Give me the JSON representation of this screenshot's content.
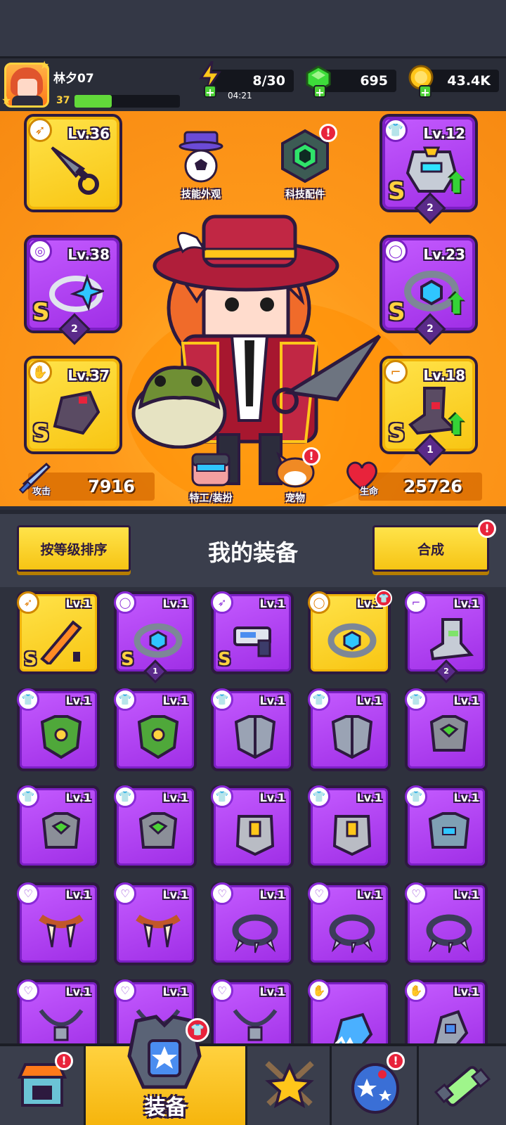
{
  "player": {
    "name": "林夕07",
    "level": "37",
    "xp_fraction": 0.35
  },
  "resources": {
    "energy": "8/30",
    "energy_timer": "04:21",
    "gems": "695",
    "coins": "43.4K"
  },
  "features": {
    "skill_skin": "技能外观",
    "tech_parts": "科技配件",
    "agent_outfit": "特工/装扮",
    "pet": "宠物"
  },
  "equipped": {
    "weapon": {
      "level": "Lv.36",
      "type_icon": "kunai-icon"
    },
    "ring": {
      "level": "Lv.38",
      "rank": "S",
      "stars": "2",
      "type_icon": "ring-icon"
    },
    "gloves": {
      "level": "Lv.37",
      "rank": "S",
      "type_icon": "glove-icon"
    },
    "armor": {
      "level": "Lv.12",
      "rank": "S",
      "stars": "2",
      "type_icon": "shirt-icon",
      "upgradable": true
    },
    "belt": {
      "level": "Lv.23",
      "rank": "S",
      "stars": "2",
      "type_icon": "belt-icon",
      "upgradable": true
    },
    "boots": {
      "level": "Lv.18",
      "rank": "S",
      "stars": "1",
      "type_icon": "boot-icon",
      "upgradable": true
    }
  },
  "stats": {
    "attack_label": "攻击",
    "attack": "7916",
    "hp_label": "生命",
    "hp": "25726"
  },
  "equipment_section": {
    "sort_button": "按等级排序",
    "title": "我的装备",
    "merge_button": "合成"
  },
  "inventory": [
    {
      "level": "Lv.1",
      "rarity": "gold",
      "rank": "S",
      "kind": "sword"
    },
    {
      "level": "Lv.1",
      "rarity": "purple",
      "rank": "S",
      "stars": "1",
      "kind": "belt"
    },
    {
      "level": "Lv.1",
      "rarity": "purple",
      "rank": "S",
      "kind": "gun"
    },
    {
      "level": "Lv.1",
      "rarity": "gold",
      "kind": "belt",
      "new": true
    },
    {
      "level": "Lv.1",
      "rarity": "purple",
      "stars": "2",
      "kind": "boot"
    },
    {
      "level": "Lv.1",
      "rarity": "purple",
      "kind": "armor-green"
    },
    {
      "level": "Lv.1",
      "rarity": "purple",
      "kind": "armor-green"
    },
    {
      "level": "Lv.1",
      "rarity": "purple",
      "kind": "armor-steel"
    },
    {
      "level": "Lv.1",
      "rarity": "purple",
      "kind": "armor-steel"
    },
    {
      "level": "Lv.1",
      "rarity": "purple",
      "kind": "armor-gem"
    },
    {
      "level": "Lv.1",
      "rarity": "purple",
      "kind": "armor-gem"
    },
    {
      "level": "Lv.1",
      "rarity": "purple",
      "kind": "armor-gem"
    },
    {
      "level": "Lv.1",
      "rarity": "purple",
      "kind": "armor-plate"
    },
    {
      "level": "Lv.1",
      "rarity": "purple",
      "kind": "armor-plate"
    },
    {
      "level": "Lv.1",
      "rarity": "purple",
      "kind": "armor-blue"
    },
    {
      "level": "Lv.1",
      "rarity": "purple",
      "kind": "fang-necklace"
    },
    {
      "level": "Lv.1",
      "rarity": "purple",
      "kind": "fang-necklace"
    },
    {
      "level": "Lv.1",
      "rarity": "purple",
      "kind": "spike-collar"
    },
    {
      "level": "Lv.1",
      "rarity": "purple",
      "kind": "spike-collar"
    },
    {
      "level": "Lv.1",
      "rarity": "purple",
      "kind": "spike-collar"
    },
    {
      "level": "Lv.1",
      "rarity": "purple",
      "kind": "chain-necklace"
    },
    {
      "level": "Lv.1",
      "rarity": "purple",
      "kind": "chain-necklace"
    },
    {
      "level": "Lv.1",
      "rarity": "purple",
      "kind": "chain-necklace"
    },
    {
      "level": "",
      "rarity": "purple",
      "kind": "fur-glove"
    },
    {
      "level": "Lv.1",
      "rarity": "purple",
      "kind": "gauntlet"
    }
  ],
  "nav": {
    "shop": "shop-icon",
    "equipment": "装备",
    "talent": "star-swords-icon",
    "pets": "egg-icon",
    "lab": "dna-icon"
  },
  "colors": {
    "panel_orange": "#ff9a1b",
    "gold_rarity": "#f8c512",
    "purple_rarity": "#a435ee",
    "upgrade_green": "#35d437",
    "alert_red": "#e8233b"
  }
}
